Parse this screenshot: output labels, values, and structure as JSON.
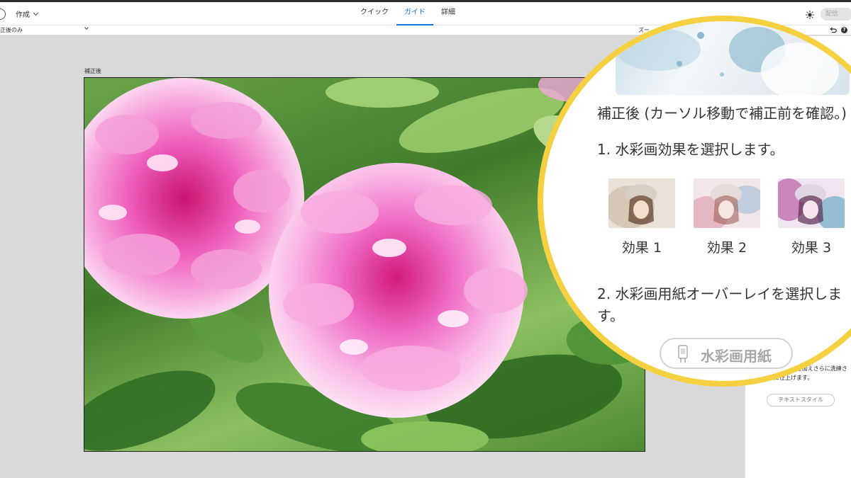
{
  "topbar": {
    "create_label": "作成",
    "tabs": [
      {
        "label": "クイック"
      },
      {
        "label": "ガイド"
      },
      {
        "label": "詳細"
      }
    ],
    "publish_label": "配信"
  },
  "viewbar": {
    "view_value": "正後のみ",
    "zoom_label": "ズー"
  },
  "canvas": {
    "label": "補正後"
  },
  "panel": {
    "text_desc": "テキストスタイルを加えさらに洗練された外観に仕上げます。",
    "text_style_button": "テキストスタイル"
  },
  "magnifier": {
    "title": "補正後 (カーソル移動で補正前を確認。)",
    "step1": "1. 水彩画効果を選択します。",
    "effects": [
      {
        "label": "効果 1"
      },
      {
        "label": "効果 2"
      },
      {
        "label": "効果 3"
      }
    ],
    "step2": "2. 水彩画用紙オーバーレイを選択します。",
    "paper_button": "水彩画用紙"
  },
  "colors": {
    "accent": "#1473e6",
    "magnifier_border": "#f5d142",
    "flower_pink": "#e83fb0"
  }
}
